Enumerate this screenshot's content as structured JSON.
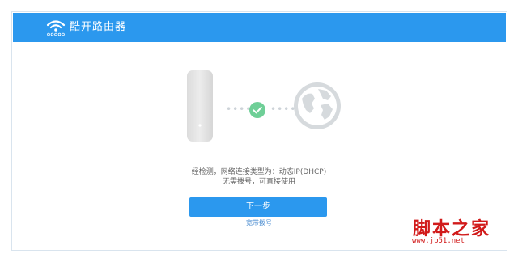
{
  "header": {
    "title": "酷开路由器",
    "logo_icon": "wifi-logo-icon"
  },
  "status": {
    "line1": "经检测，网络连接类型为：动态IP(DHCP)",
    "line2": "无需拨号，可直接使用"
  },
  "actions": {
    "next_label": "下一步",
    "alt_link": "宽带拨号"
  },
  "watermark": {
    "text": "脚本之家",
    "url": "www.jb51.net"
  },
  "colors": {
    "accent": "#2b98ee",
    "success": "#6fcf97",
    "device": "#e8e8e8",
    "globe": "#d8dcdf"
  },
  "icons": {
    "device": "router-icon",
    "connection_ok": "check-circle-icon",
    "internet": "globe-icon"
  }
}
